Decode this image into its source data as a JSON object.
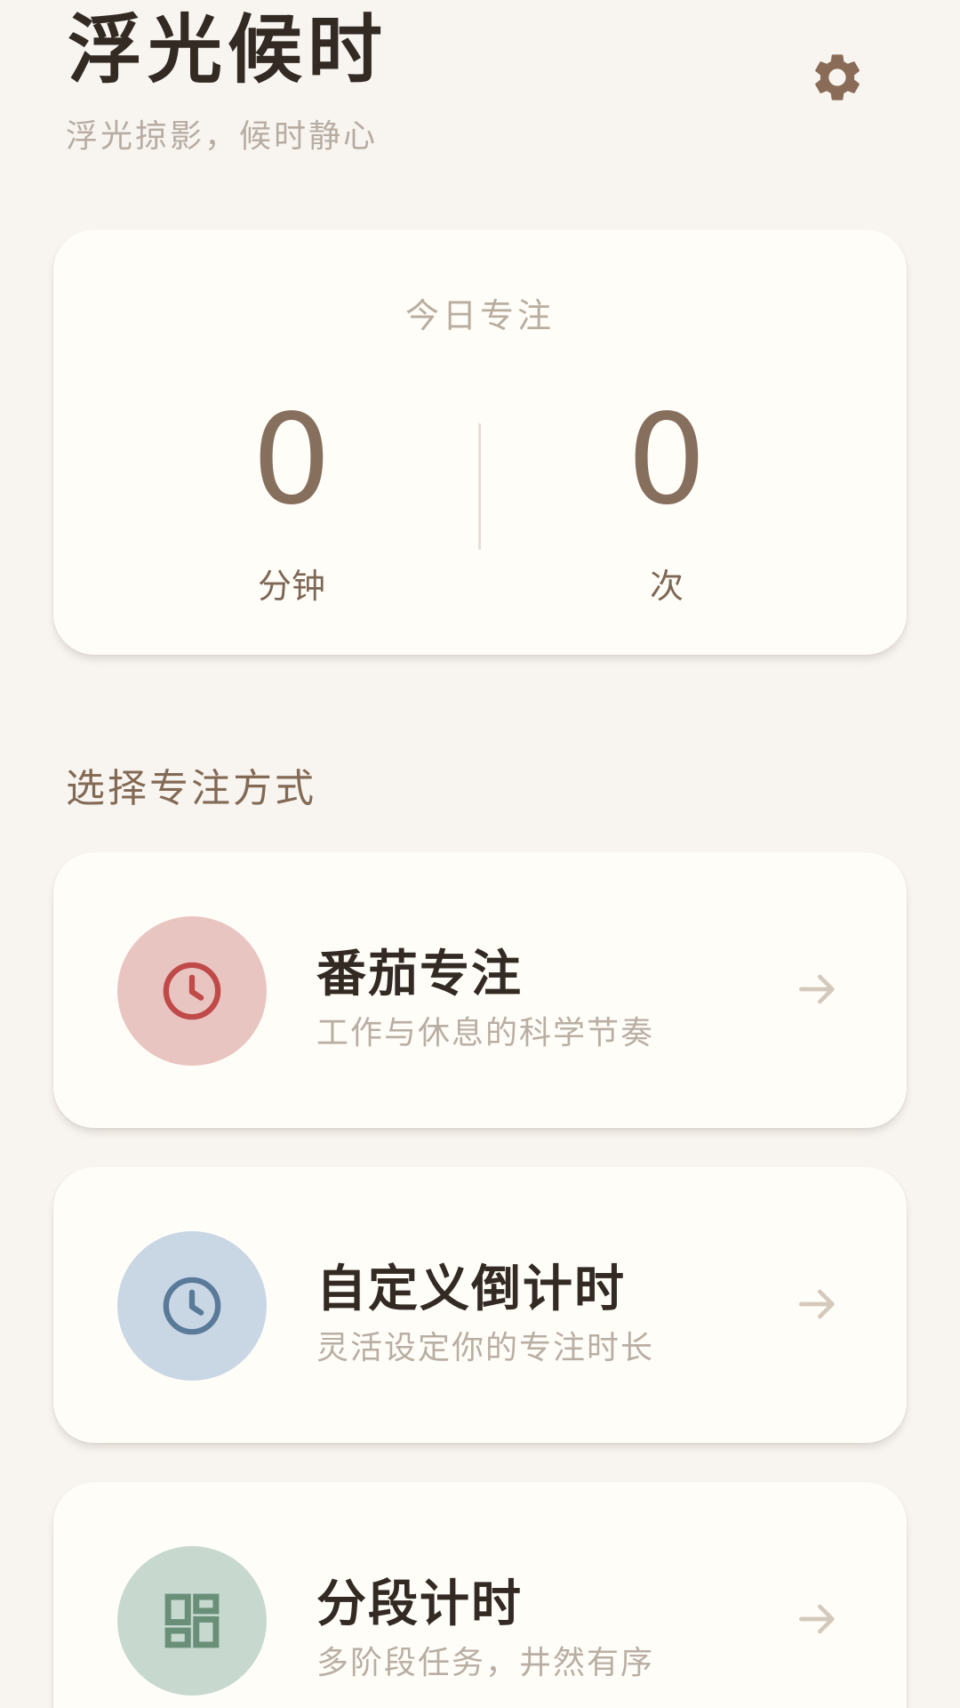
{
  "header": {
    "title": "浮光候时",
    "subtitle": "浮光掠影，候时静心",
    "settings_icon": "gear-icon"
  },
  "stats": {
    "title": "今日专注",
    "minutes_value": "0",
    "minutes_unit": "分钟",
    "sessions_value": "0",
    "sessions_unit": "次"
  },
  "modes": {
    "section_title": "选择专注方式",
    "items": [
      {
        "title": "番茄专注",
        "desc": "工作与休息的科学节奏",
        "icon": "clock-icon",
        "circle_color": "#e9c5c2",
        "icon_color": "#bf4a48"
      },
      {
        "title": "自定义倒计时",
        "desc": "灵活设定你的专注时长",
        "icon": "clock-icon",
        "circle_color": "#c9d6e4",
        "icon_color": "#5a7a99"
      },
      {
        "title": "分段计时",
        "desc": "多阶段任务，井然有序",
        "icon": "dashboard-icon",
        "circle_color": "#c7d9cf",
        "icon_color": "#6a8f78"
      }
    ]
  },
  "colors": {
    "background": "#f8f5f1",
    "card": "#fffdf8",
    "accent_brown": "#876f5e",
    "settings_icon": "#8a6b58",
    "arrow": "#d5c9bc"
  }
}
